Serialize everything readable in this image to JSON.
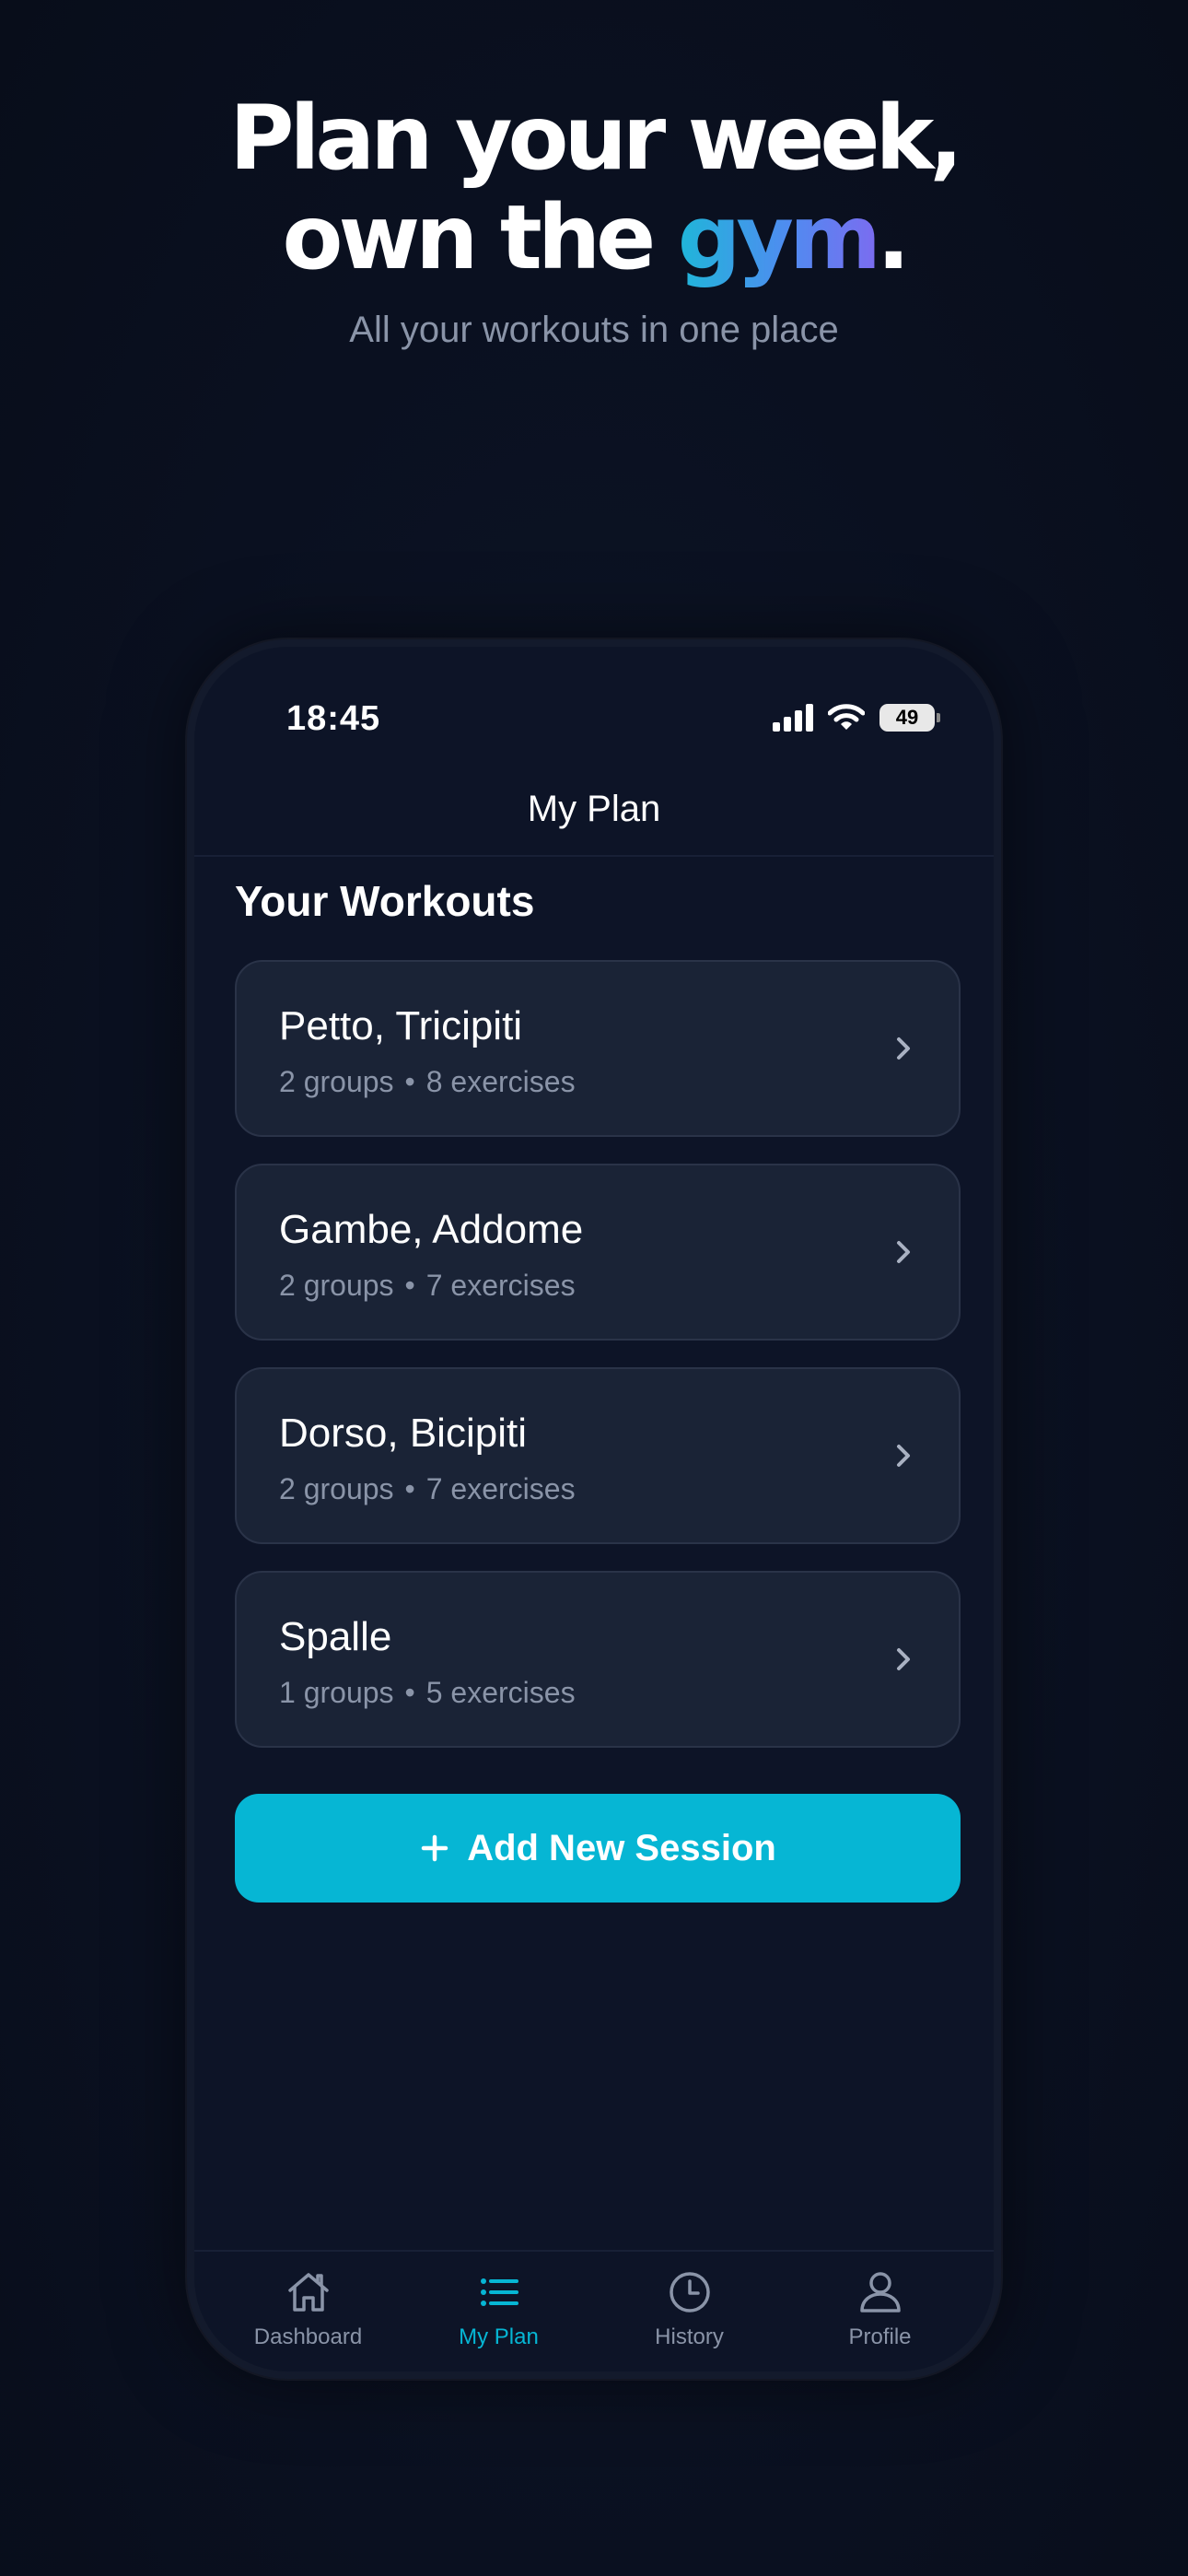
{
  "hero": {
    "title_line1": "Plan your week,",
    "title_line2_pre": "own the ",
    "title_line2_accent": "gym",
    "title_line2_post": ".",
    "subtitle": "All your workouts in one place"
  },
  "status_bar": {
    "time": "18:45",
    "battery": "49"
  },
  "nav": {
    "title": "My Plan"
  },
  "section": {
    "title": "Your Workouts"
  },
  "workouts": [
    {
      "name": "Petto, Tricipiti",
      "groups": "2 groups",
      "exercises": "8 exercises"
    },
    {
      "name": "Gambe, Addome",
      "groups": "2 groups",
      "exercises": "7 exercises"
    },
    {
      "name": "Dorso, Bicipiti",
      "groups": "2 groups",
      "exercises": "7 exercises"
    },
    {
      "name": "Spalle",
      "groups": "1 groups",
      "exercises": "5 exercises"
    }
  ],
  "workout_separator": "•",
  "add_button": {
    "label": "Add New Session",
    "icon": "plus-icon"
  },
  "tabs": [
    {
      "label": "Dashboard",
      "icon": "home-icon",
      "active": false
    },
    {
      "label": "My Plan",
      "icon": "list-icon",
      "active": true
    },
    {
      "label": "History",
      "icon": "clock-icon",
      "active": false
    },
    {
      "label": "Profile",
      "icon": "user-icon",
      "active": false
    }
  ],
  "colors": {
    "accent": "#06b6d4",
    "background": "#0a1020",
    "card": "#1a2336",
    "muted_text": "#8a94a8"
  }
}
